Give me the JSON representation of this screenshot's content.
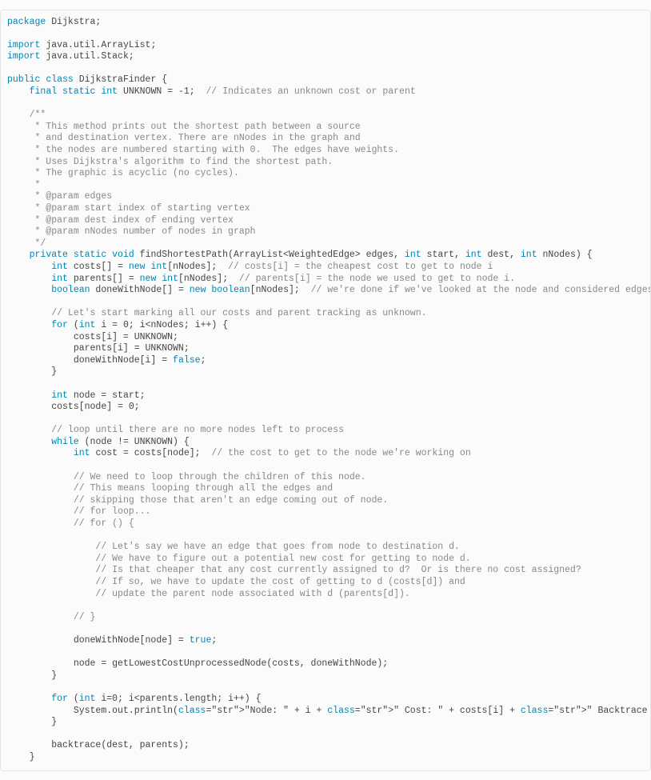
{
  "code": {
    "l01": "package Dijkstra;",
    "l02": "",
    "l03": "import java.util.ArrayList;",
    "l04": "import java.util.Stack;",
    "l05": "",
    "l06": "public class DijkstraFinder {",
    "l07": "    final static int UNKNOWN = -1;  // Indicates an unknown cost or parent",
    "l08": "",
    "l09": "    /**",
    "l10": "     * This method prints out the shortest path between a source",
    "l11": "     * and destination vertex. There are nNodes in the graph and",
    "l12": "     * the nodes are numbered starting with 0.  The edges have weights.",
    "l13": "     * Uses Dijkstra's algorithm to find the shortest path.",
    "l14": "     * The graphic is acyclic (no cycles).",
    "l15": "     *",
    "l16": "     * @param edges",
    "l17": "     * @param start index of starting vertex",
    "l18": "     * @param dest index of ending vertex",
    "l19": "     * @param nNodes number of nodes in graph",
    "l20": "     */",
    "l21": "    private static void findShortestPath(ArrayList<WeightedEdge> edges, int start, int dest, int nNodes) {",
    "l22": "        int costs[] = new int[nNodes];  // costs[i] = the cheapest cost to get to node i",
    "l23": "        int parents[] = new int[nNodes];  // parents[i] = the node we used to get to node i.",
    "l24": "        boolean doneWithNode[] = new boolean[nNodes];  // we're done if we've looked at the node and considered edges",
    "l25": "",
    "l26": "        // Let's start marking all our costs and parent tracking as unknown.",
    "l27": "        for (int i = 0; i<nNodes; i++) {",
    "l28": "            costs[i] = UNKNOWN;",
    "l29": "            parents[i] = UNKNOWN;",
    "l30": "            doneWithNode[i] = false;",
    "l31": "        }",
    "l32": "",
    "l33": "        int node = start;",
    "l34": "        costs[node] = 0;",
    "l35": "",
    "l36": "        // loop until there are no more nodes left to process",
    "l37": "        while (node != UNKNOWN) {",
    "l38": "            int cost = costs[node];  // the cost to get to the node we're working on",
    "l39": "",
    "l40": "            // We need to loop through the children of this node.",
    "l41": "            // This means looping through all the edges and",
    "l42": "            // skipping those that aren't an edge coming out of node.",
    "l43": "            // for loop...",
    "l44": "            // for () {",
    "l45": "",
    "l46": "                // Let's say we have an edge that goes from node to destination d.",
    "l47": "                // We have to figure out a potential new cost for getting to node d.",
    "l48": "                // Is that cheaper that any cost currently assigned to d?  Or is there no cost assigned?",
    "l49": "                // If so, we have to update the cost of getting to d (costs[d]) and",
    "l50": "                // update the parent node associated with d (parents[d]).",
    "l51": "",
    "l52": "            // }",
    "l53": "",
    "l54": "            doneWithNode[node] = true;",
    "l55": "",
    "l56": "            node = getLowestCostUnprocessedNode(costs, doneWithNode);",
    "l57": "        }",
    "l58": "",
    "l59": "        for (int i=0; i<parents.length; i++) {",
    "l60": "            System.out.println(\"Node: \" + i + \" Cost: \" + costs[i] + \" Backtrace Parent: \" + parents[i]);",
    "l61": "        }",
    "l62": "",
    "l63": "        backtrace(dest, parents);",
    "l64": "    }"
  }
}
